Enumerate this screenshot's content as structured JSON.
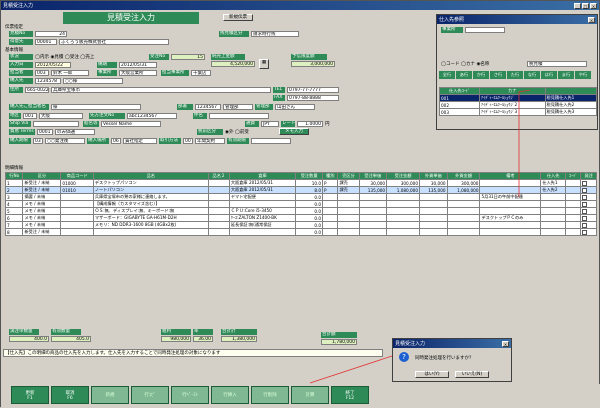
{
  "window": {
    "title": "見積受注入力"
  },
  "header": {
    "title": "見積受注入力",
    "mode_badge": "新規伝票"
  },
  "section_denpyo": {
    "label": "伝票指定"
  },
  "mitsumori": {
    "label": "見積No",
    "value": "24"
  },
  "kanryo": {
    "label": "残見積区分",
    "value": "請求時行残"
  },
  "tokuisaki": {
    "label": "得意先",
    "code": "00001",
    "name": "ふくろう販売株式会社"
  },
  "section_kihon": {
    "label": "基本情報"
  },
  "jokyo": {
    "label": "状況",
    "opt1": "内示",
    "opt2": "見積",
    "opt3": "受注",
    "opt4": "売上",
    "selected": "見積"
  },
  "juchu_no": {
    "label": "受注No",
    "value": "15"
  },
  "koho_kingaku": {
    "label": "純売上金額"
  },
  "yosan": {
    "label": "予信限度額",
    "value": "3,000,000"
  },
  "koho_value": "4,520,000",
  "nyuryoku_date": {
    "label": "入力日",
    "value": "2012/05/22"
  },
  "noki": {
    "label": "納期",
    "value": "2012/05/31"
  },
  "tanto": {
    "label": "担当者",
    "code": "003",
    "name": "鈴木 一郎"
  },
  "jigyosho": {
    "label": "事業所",
    "value": "大阪営業所"
  },
  "tanto_jigyosho": {
    "label": "担当事業所",
    "value": "千葉店"
  },
  "nohin": {
    "label": "納入先",
    "code": "1234578",
    "name": "○○様"
  },
  "jusho": {
    "label": "住所",
    "zip": "665-0022",
    "addr": "兵庫県宝塚市"
  },
  "tel": {
    "label": "TEL",
    "value": "0797-77-7777"
  },
  "fax": {
    "label": "FAX",
    "value": "0797-88-8888"
  },
  "nohin_tanto": {
    "label": "納入先ご担当者名",
    "value": "様"
  },
  "busho": {
    "label": "部署",
    "code": "1234567",
    "name": "管理部"
  },
  "yakushoku": {
    "label": "管理部",
    "value": "山田さん"
  },
  "chiku": {
    "label": "地区",
    "code": "001",
    "name": "大阪"
  },
  "saki_chumon": {
    "label": "先方注文No",
    "value": "abc1234567"
  },
  "kenmei": {
    "label": "件名",
    "value": ""
  },
  "ship_via": {
    "label": "Ship Via",
    "value": ""
  },
  "senmei": {
    "label": "船名等",
    "value": "Vessel Name"
  },
  "tsuka": {
    "label": "通貨",
    "value": "JPY"
  },
  "rate": {
    "label": "レート",
    "value": "1.0000",
    "unit": "円"
  },
  "boeki": {
    "label": "貿易 Terms",
    "code": "0001",
    "name": "のみ価通"
  },
  "zei_kbn": {
    "label": "税前区分",
    "opt1": "外",
    "opt2": "前受"
  },
  "memo_btn": "メモ入力",
  "nohin_kbn": {
    "label": "納入期限",
    "value": "03",
    "text": "○○発注後"
  },
  "nohin_basho": {
    "label": "納入場所",
    "value": "06",
    "text": "貴社指定"
  },
  "torihiki": {
    "label": "取引方法",
    "value": "00",
    "text": "年間契約"
  },
  "yuko": {
    "label": "有効期限",
    "value": ""
  },
  "section_meisai": {
    "label": "明細情報"
  },
  "table": {
    "headers": [
      "行No",
      "区分",
      "商品コード",
      "品名",
      "品名２",
      "倉庫",
      "受注数量",
      "種別",
      "売区分",
      "受注単価",
      "受注金額",
      "外貨単価",
      "外貨金額",
      "備考",
      "仕入先",
      "ｺｰﾄﾞ",
      "発注"
    ],
    "rows": [
      {
        "no": "1",
        "kbn": "新受注",
        "kbn2": "未納",
        "code": "01000",
        "name": "デスクトップパソコン",
        "soko": "大阪倉庫",
        "date": "2012/05/31",
        "qty": "10.0",
        "unit": "P",
        "uri": "課売",
        "tanka": "30,000",
        "kingaku": "300,000",
        "gai_tanka": "30,000",
        "gai_kin": "300,000",
        "biko": "",
        "shiire": "仕入先1"
      },
      {
        "no": "2",
        "kbn": "新受注",
        "kbn2": "未納",
        "code": "01010",
        "name": "ノートパソコン",
        "soko": "大阪倉庫",
        "date": "2012/05/31",
        "qty": "8.0",
        "unit": "P",
        "uri": "課売",
        "tanka": "135,000",
        "kingaku": "1,080,000",
        "gai_tanka": "135,000",
        "gai_kin": "1,080,000",
        "biko": "",
        "shiire": "仕入先2"
      },
      {
        "no": "3",
        "kbn": "摘要",
        "kbn2": "未納",
        "code": "",
        "name": "兵庫県宝塚市の鷲の家様に連絡します。",
        "soko": "ヤマト宅配便",
        "date": "",
        "qty": "0.0",
        "unit": "",
        "uri": "",
        "tanka": "",
        "kingaku": "",
        "gai_tanka": "",
        "gai_kin": "",
        "biko": "5月31日の午前中配達",
        "shiire": ""
      },
      {
        "no": "4",
        "kbn": "メモ",
        "kbn2": "未納",
        "code": "",
        "name": "【構成情報（カスタマイズ含む）】",
        "soko": "",
        "date": "",
        "qty": "0.0",
        "unit": "",
        "uri": "",
        "tanka": "",
        "kingaku": "",
        "gai_tanka": "",
        "gai_kin": "",
        "biko": "",
        "shiire": ""
      },
      {
        "no": "5",
        "kbn": "メモ",
        "kbn2": "未納",
        "code": "",
        "name": "ＯＳ:無、ディスプレイ:無、キーボード:無",
        "soko": "ＣＰＵ:Core i5-3450",
        "date": "",
        "qty": "0.0",
        "unit": "",
        "uri": "",
        "tanka": "",
        "kingaku": "",
        "gai_tanka": "",
        "gai_kin": "",
        "biko": "",
        "shiire": ""
      },
      {
        "no": "6",
        "kbn": "メモ",
        "kbn2": "未納",
        "code": "",
        "name": "マザーボード：GIGABYTE GA-H61M-D2H",
        "soko": "ｹｰｽ:ZALTON Z1400-BK",
        "date": "",
        "qty": "0.0",
        "unit": "",
        "uri": "",
        "tanka": "",
        "kingaku": "",
        "gai_tanka": "",
        "gai_kin": "",
        "biko": "デスクトップＰＣのみ",
        "shiire": ""
      },
      {
        "no": "7",
        "kbn": "メモ",
        "kbn2": "未納",
        "code": "",
        "name": "メモリ：ND DDR3-1600 8GB (4GBx2枚)",
        "soko": "延長保証:無(通常保証",
        "date": "",
        "qty": "0.0",
        "unit": "",
        "uri": "",
        "tanka": "",
        "kingaku": "",
        "gai_tanka": "",
        "gai_kin": "",
        "biko": "",
        "shiire": ""
      },
      {
        "no": "8",
        "kbn": "新受注",
        "kbn2": "未納",
        "code": "",
        "name": "",
        "soko": "",
        "date": "",
        "qty": "0.0",
        "unit": "",
        "uri": "",
        "tanka": "",
        "kingaku": "",
        "gai_tanka": "",
        "gai_kin": "",
        "biko": "",
        "shiire": ""
      }
    ]
  },
  "totals": {
    "juchu_qty_label": "満注単数量",
    "juchu_qty": "400.0",
    "yuko_label": "有効数量",
    "yuko_qty": "405.0",
    "arari_label": "粗利",
    "arari": "980,000",
    "ritsu_label": "率",
    "ritsu": "36.00",
    "goukei_label": "合計計",
    "goukei": "1,380,000",
    "zeikomi_label": "合計額",
    "zeikomi": "1,780,000"
  },
  "status_msg": "【仕入先】この明細の商品の仕入先を入力します。仕入先を入力することで同時発注処理の対象になります",
  "fkeys": [
    {
      "label": "更新",
      "key": "F1"
    },
    {
      "label": "取消",
      "key": "F6"
    },
    {
      "label": "新規",
      "key": ""
    },
    {
      "label": "行ｺﾋﾟ",
      "key": ""
    },
    {
      "label": "行ﾍﾟｰｽﾄ",
      "key": ""
    },
    {
      "label": "行挿入",
      "key": ""
    },
    {
      "label": "行削除",
      "key": ""
    },
    {
      "label": "計算",
      "key": ""
    },
    {
      "label": "終了",
      "key": "F12"
    }
  ],
  "supplier": {
    "title": "仕入先参照",
    "jigyosho_label": "事業所",
    "opt_code": "コード",
    "opt_kana": "カナ",
    "opt_name": "名称",
    "search_value": "税見積",
    "tabs": [
      "全行",
      "あ行",
      "か行",
      "さ行",
      "た行",
      "な行",
      "は行",
      "ま行",
      "や行"
    ],
    "col_code": "仕入先ｺｰﾄﾞ",
    "col_kana": "カナ",
    "rows": [
      {
        "code": "001",
        "kana": "ｱｲﾃﾞｨｰｴﾑﾂｰﾙｼｮｳｼﾞ",
        "name": "税見積仕入先1"
      },
      {
        "code": "002",
        "kana": "ｱｲﾃﾞｨｰｴﾑﾂｰﾙｼｮｳｼﾞ2",
        "name": "税見積仕入先2"
      },
      {
        "code": "003",
        "kana": "ｱｲﾃﾞｨｰｴﾑﾂｰﾙｼｮｳｼﾞ3",
        "name": "税見積仕入先3"
      }
    ]
  },
  "dialog": {
    "title": "見積受注入力",
    "message": "同時発注処理を行いますか？",
    "yes": "はい(Y)",
    "no": "いいえ(N)"
  }
}
